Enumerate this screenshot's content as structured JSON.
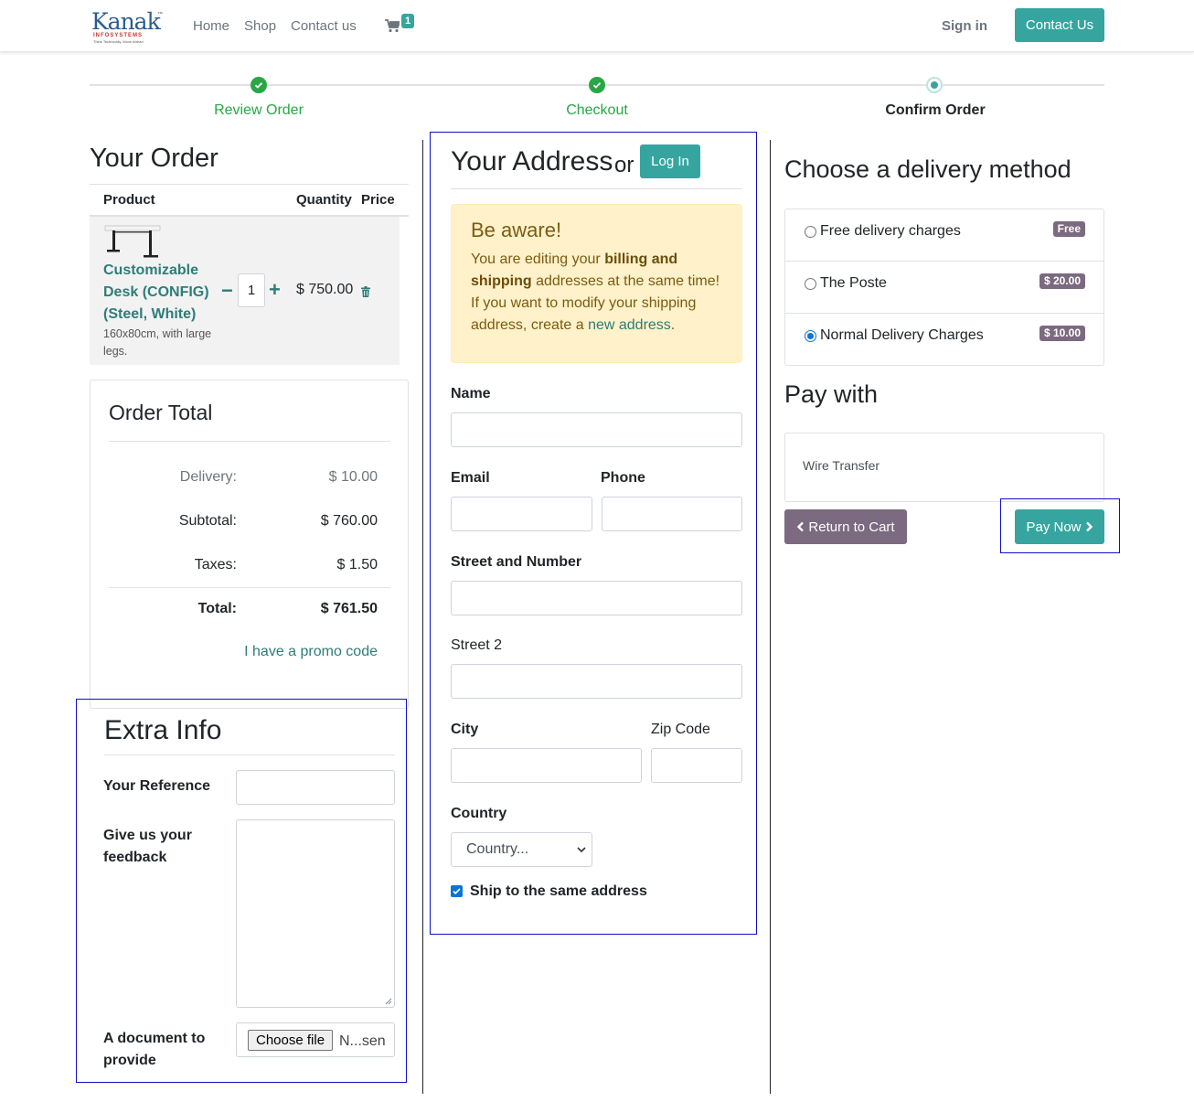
{
  "header": {
    "logo": {
      "word": "Kanak",
      "sub": "INFOSYSTEMS",
      "tagline": "Think Technically, Move Ahead",
      "reg": "™"
    },
    "nav": [
      "Home",
      "Shop",
      "Contact us"
    ],
    "cart_count": "1",
    "sign_in": "Sign in",
    "contact_button": "Contact Us",
    "accent_color": "#37a59f"
  },
  "steps": [
    {
      "label": "Review Order",
      "state": "done"
    },
    {
      "label": "Checkout",
      "state": "done"
    },
    {
      "label": "Confirm Order",
      "state": "current"
    }
  ],
  "order": {
    "title": "Your Order",
    "columns": {
      "product": "Product",
      "quantity": "Quantity",
      "price": "Price"
    },
    "items": [
      {
        "name": "Customizable Desk (CONFIG) (Steel, White)",
        "description": "160x80cm, with large legs.",
        "quantity": "1",
        "price": "$ 750.00"
      }
    ],
    "total_card": {
      "title": "Order Total",
      "rows": [
        {
          "label": "Delivery:",
          "value": "$ 10.00"
        },
        {
          "label": "Subtotal:",
          "value": "$ 760.00"
        },
        {
          "label": "Taxes:",
          "value": "$ 1.50"
        },
        {
          "label": "Total:",
          "value": "$ 761.50"
        }
      ],
      "promo": "I have a promo code"
    }
  },
  "extra_info": {
    "title": "Extra Info",
    "reference_label": "Your Reference",
    "feedback_label": "Give us your feedback",
    "document_label": "A document to provide",
    "file_button": "Choose file",
    "file_status": "N...sen"
  },
  "address": {
    "title": "Your Address",
    "or": "or",
    "login_button": "Log In",
    "alert": {
      "title": "Be aware!",
      "text_1": "You are editing your ",
      "bold": "billing and shipping",
      "text_2": " addresses at the same time! If you want to modify your shipping address, create a ",
      "link": "new address",
      "text_3": "."
    },
    "fields": {
      "name": "Name",
      "email": "Email",
      "phone": "Phone",
      "street": "Street and Number",
      "street2": "Street 2",
      "city": "City",
      "zip": "Zip Code",
      "country": "Country",
      "country_placeholder": "Country..."
    },
    "ship_same": "Ship to the same address",
    "ship_same_checked": true
  },
  "delivery": {
    "title": "Choose a delivery method",
    "methods": [
      {
        "label": "Free delivery charges",
        "badge": "Free",
        "selected": false
      },
      {
        "label": "The Poste",
        "badge": "$ 20.00",
        "selected": false
      },
      {
        "label": "Normal Delivery Charges",
        "badge": "$ 10.00",
        "selected": true
      }
    ]
  },
  "payment": {
    "title": "Pay with",
    "method": "Wire Transfer",
    "return_button": "Return to Cart",
    "pay_button": "Pay Now"
  }
}
